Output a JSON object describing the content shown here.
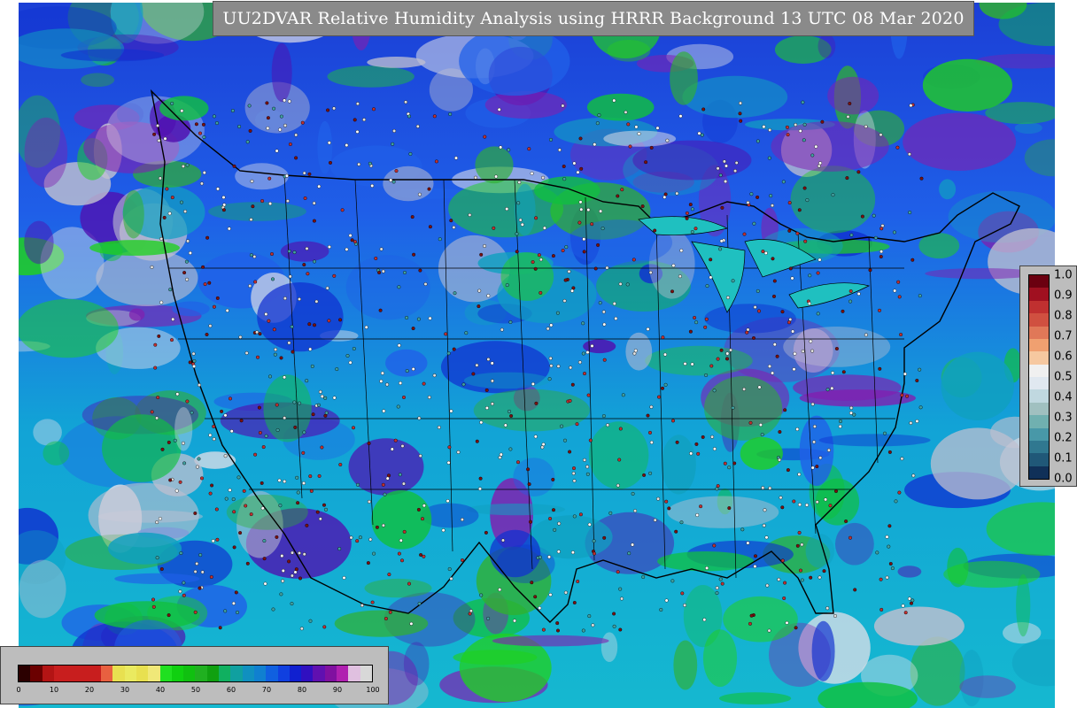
{
  "title": "UU2DVAR Relative Humidity Analysis using HRRR Background 13 UTC 08 Mar 2020",
  "legend_main": {
    "ticks": [
      "0",
      "10",
      "20",
      "30",
      "40",
      "50",
      "60",
      "70",
      "80",
      "90",
      "100"
    ],
    "colors": [
      "#2b0000",
      "#6b0000",
      "#b31414",
      "#c81e1e",
      "#c81e1e",
      "#c81e1e",
      "#c81e1e",
      "#e86040",
      "#e8e050",
      "#eaea60",
      "#e8e050",
      "#f0e878",
      "#20e020",
      "#10d010",
      "#10c010",
      "#20b020",
      "#10a010",
      "#10b060",
      "#10a0a0",
      "#1090c0",
      "#1080d0",
      "#1060e0",
      "#1040e0",
      "#1020d0",
      "#3010c0",
      "#6010b0",
      "#8010a0",
      "#b020b0",
      "#e0c0e0",
      "#d8d8d8"
    ]
  },
  "legend_obs": {
    "ticks": [
      "1.0",
      "0.9",
      "0.8",
      "0.7",
      "0.6",
      "0.5",
      "0.4",
      "0.3",
      "0.2",
      "0.1",
      "0.0"
    ],
    "colors": [
      "#6b0010",
      "#a01020",
      "#c03030",
      "#d05040",
      "#e07858",
      "#f0a070",
      "#f6c8a0",
      "#f0f0f0",
      "#e0e8f0",
      "#c0d8e0",
      "#a0c0c0",
      "#70b0b0",
      "#4898a8",
      "#307890",
      "#205878",
      "#103058"
    ]
  },
  "icons": [
    "weather-map-icon"
  ]
}
